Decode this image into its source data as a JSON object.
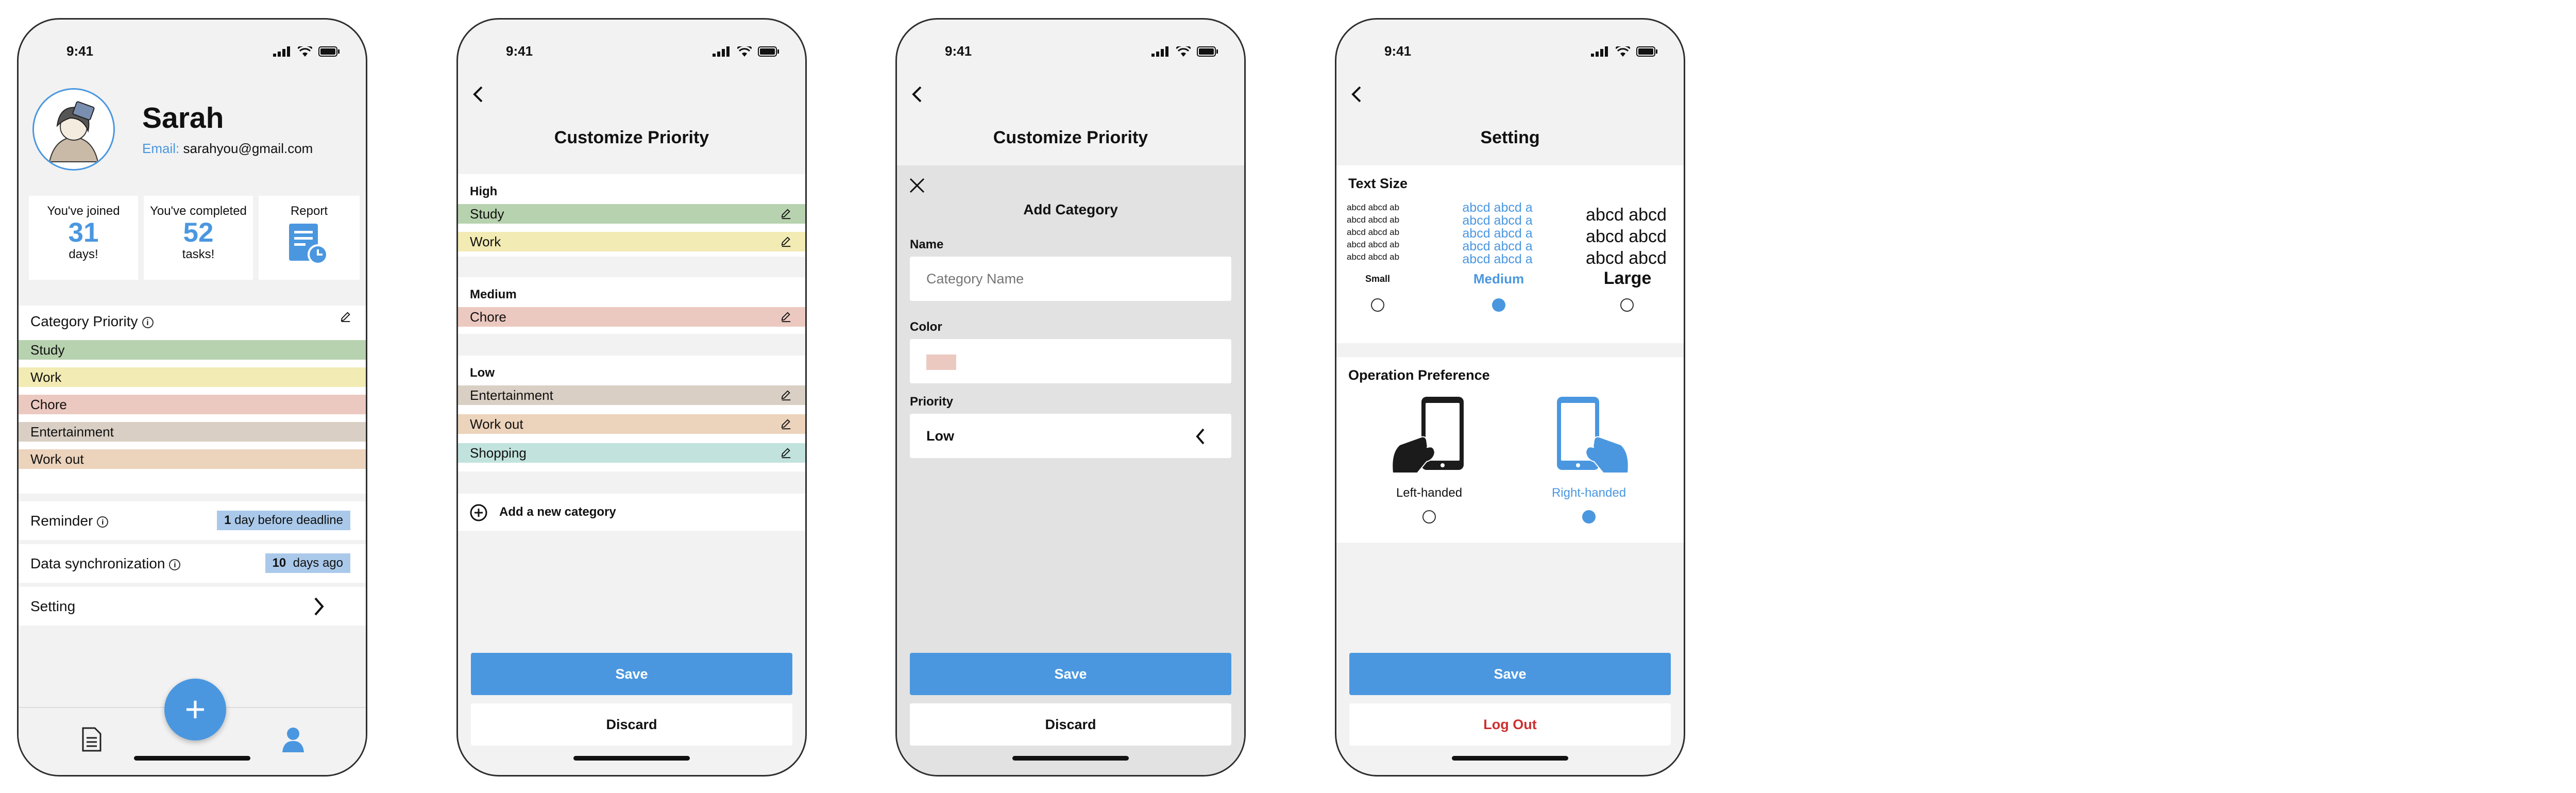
{
  "status_time": "9:41",
  "colors": {
    "accent": "#4a97e0",
    "study": "#b7d2ae",
    "work": "#f2ebb3",
    "chore": "#ecc9c0",
    "entertainment": "#d9cfc4",
    "workout": "#ecd3bb",
    "shopping": "#c2e3dd",
    "logout": "#cf2e2e"
  },
  "profile": {
    "name": "Sarah",
    "email_label": "Email:",
    "email": "sarahyou@gmail.com",
    "stats": [
      {
        "caption": "You've joined",
        "value": "31",
        "unit": "days!"
      },
      {
        "caption": "You've completed",
        "value": "52",
        "unit": "tasks!"
      }
    ],
    "report_label": "Report",
    "category_priority_label": "Category Priority",
    "categories": [
      "Study",
      "Work",
      "Chore",
      "Entertainment",
      "Work out"
    ],
    "reminder_label": "Reminder",
    "reminder_value_num": "1",
    "reminder_value_text": "day before deadline",
    "sync_label": "Data synchronization",
    "sync_value_num": "10",
    "sync_value_text": "days ago",
    "setting_label": "Setting",
    "fab_symbol": "+"
  },
  "customize": {
    "title": "Customize Priority",
    "groups": [
      {
        "label": "High",
        "items": [
          "Study",
          "Work"
        ]
      },
      {
        "label": "Medium",
        "items": [
          "Chore"
        ]
      },
      {
        "label": "Low",
        "items": [
          "Entertainment",
          "Work out",
          "Shopping"
        ]
      }
    ],
    "add_label": "Add a new category",
    "save_label": "Save",
    "discard_label": "Discard"
  },
  "add_category": {
    "title": "Customize Priority",
    "modal_title": "Add Category",
    "name_label": "Name",
    "name_placeholder": "Category Name",
    "color_label": "Color",
    "priority_label": "Priority",
    "priority_value": "Low",
    "save_label": "Save",
    "discard_label": "Discard"
  },
  "setting": {
    "title": "Setting",
    "text_size_label": "Text Size",
    "sample_text_small": "abcd abcd ab",
    "sample_text_medium": "abcd abcd a",
    "sample_text_large": "abcd abcd",
    "sizes": [
      "Small",
      "Medium",
      "Large"
    ],
    "selected_size": "Medium",
    "operation_label": "Operation Preference",
    "hands": [
      "Left-handed",
      "Right-handed"
    ],
    "selected_hand": "Right-handed",
    "save_label": "Save",
    "logout_label": "Log Out"
  }
}
